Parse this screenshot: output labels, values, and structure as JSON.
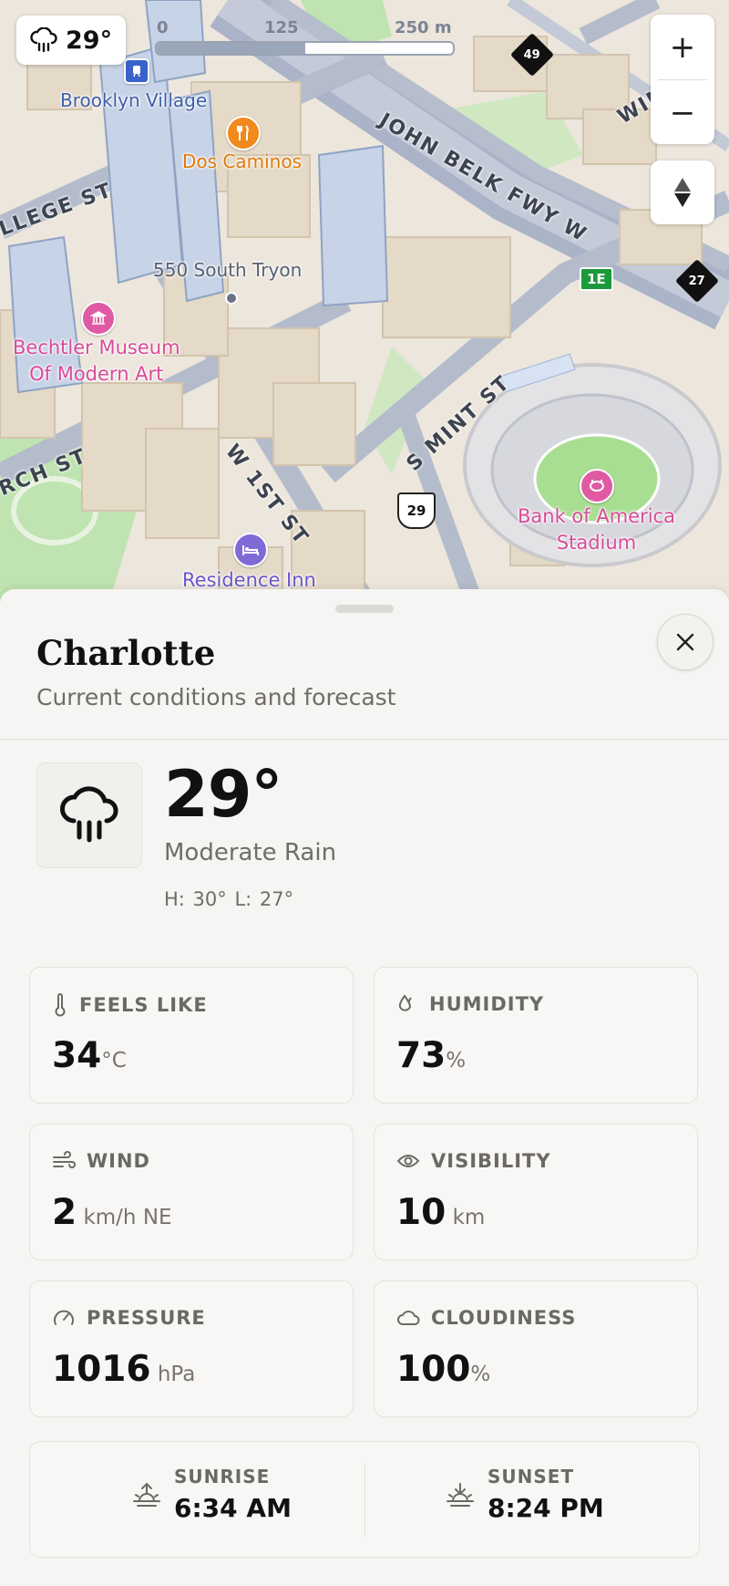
{
  "map": {
    "weather_chip": {
      "temp": "29°",
      "icon": "rain-cloud-icon"
    },
    "scale": {
      "ticks": [
        "0",
        "125",
        "250 m"
      ],
      "fill_fraction": 0.5
    },
    "zoom": {
      "in": "+",
      "out": "−"
    },
    "labels": {
      "brooklyn_village": "Brooklyn Village",
      "dos_caminos": "Dos Caminos",
      "south_tryon": "550 South Tryon",
      "bechtler_line1": "Bechtler Museum",
      "bechtler_line2": "Of Modern Art",
      "boa_line1": "Bank of America",
      "boa_line2": "Stadium",
      "residence_inn": "Residence Inn"
    },
    "streets": {
      "college": "LLEGE ST",
      "john_belk": "JOHN BELK FWY W",
      "win": "WIN",
      "mint": "S MINT ST",
      "first": "W 1ST ST",
      "church": "RCH ST"
    },
    "shields": {
      "i49": "49",
      "i27": "27",
      "us29": "29",
      "exit": "1E"
    }
  },
  "sheet": {
    "city": "Charlotte",
    "subtitle": "Current conditions and forecast",
    "current": {
      "temp": "29°",
      "condition": "Moderate Rain",
      "hilo": "H: 30°   L: 27°"
    },
    "metrics": [
      {
        "label": "FEELS LIKE",
        "value": "34",
        "unit": "°C",
        "icon": "thermometer-icon"
      },
      {
        "label": "HUMIDITY",
        "value": "73",
        "unit": "%",
        "icon": "droplets-icon"
      },
      {
        "label": "WIND",
        "value": "2",
        "unit": " km/h  NE",
        "icon": "wind-icon"
      },
      {
        "label": "VISIBILITY",
        "value": "10",
        "unit": " km",
        "icon": "eye-icon"
      },
      {
        "label": "PRESSURE",
        "value": "1016",
        "unit": " hPa",
        "icon": "gauge-icon"
      },
      {
        "label": "CLOUDINESS",
        "value": "100",
        "unit": "%",
        "icon": "cloud-icon"
      }
    ],
    "sunrise": {
      "label": "SUNRISE",
      "time": "6:34 AM"
    },
    "sunset": {
      "label": "SUNSET",
      "time": "8:24 PM"
    }
  },
  "colors": {
    "map_bg": "#ece6dc",
    "poi_pink": "#d84a98",
    "poi_orange": "#e07a0b",
    "poi_purple": "#6a54c9",
    "park_green": "#bfe3b1"
  }
}
